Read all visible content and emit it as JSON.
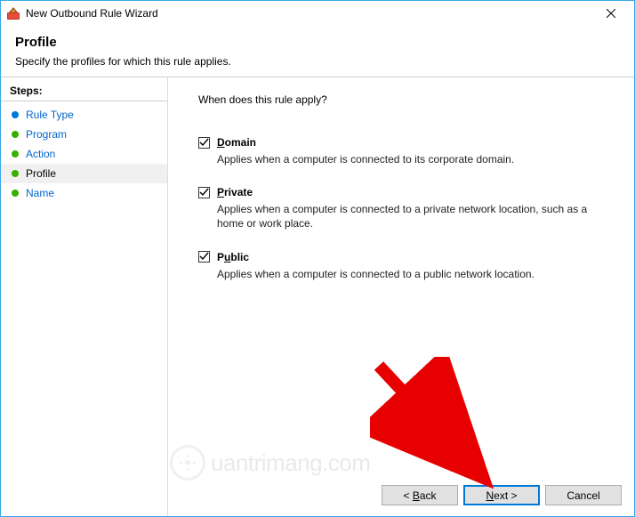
{
  "titlebar": {
    "title": "New Outbound Rule Wizard"
  },
  "header": {
    "title": "Profile",
    "subtitle": "Specify the profiles for which this rule applies."
  },
  "sidebar": {
    "heading": "Steps:",
    "items": [
      {
        "label": "Rule Type"
      },
      {
        "label": "Program"
      },
      {
        "label": "Action"
      },
      {
        "label": "Profile"
      },
      {
        "label": "Name"
      }
    ]
  },
  "main": {
    "question": "When does this rule apply?",
    "options": [
      {
        "key": "D",
        "rest": "omain",
        "checked": true,
        "desc": "Applies when a computer is connected to its corporate domain."
      },
      {
        "key": "P",
        "rest": "rivate",
        "checked": true,
        "desc": "Applies when a computer is connected to a private network location, such as a home or work place."
      },
      {
        "key": "u",
        "pre": "P",
        "rest": "blic",
        "checked": true,
        "desc": "Applies when a computer is connected to a public network location."
      }
    ]
  },
  "footer": {
    "back_pre": "< ",
    "back_key": "B",
    "back_rest": "ack",
    "next_key": "N",
    "next_rest": "ext >",
    "cancel": "Cancel"
  },
  "watermark": {
    "text": "uantrimang.com"
  }
}
